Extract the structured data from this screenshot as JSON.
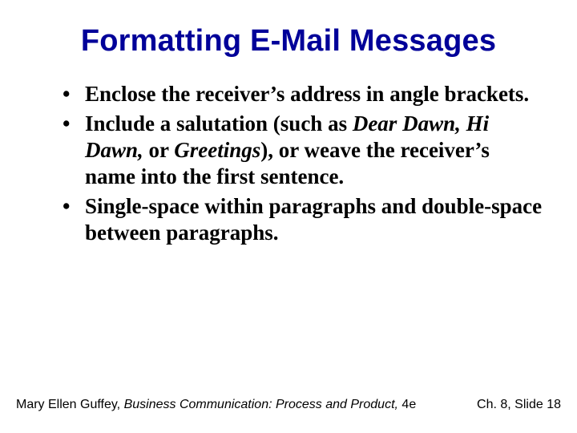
{
  "title": "Formatting E-Mail Messages",
  "bullets": {
    "b1": "Enclose the receiver’s address in angle brackets.",
    "b2a": "Include a salutation (such as ",
    "b2b": "Dear Dawn, Hi Dawn,",
    "b2c": " or ",
    "b2d": "Greetings",
    "b2e": "), or weave the receiver’s name into the first sentence.",
    "b3": "Single-space within paragraphs and double-space between paragraphs."
  },
  "footer": {
    "author": "Mary Ellen Guffey, ",
    "book": "Business Communication: Process and Product,",
    "edition": " 4e",
    "right": "Ch. 8, Slide 18"
  }
}
